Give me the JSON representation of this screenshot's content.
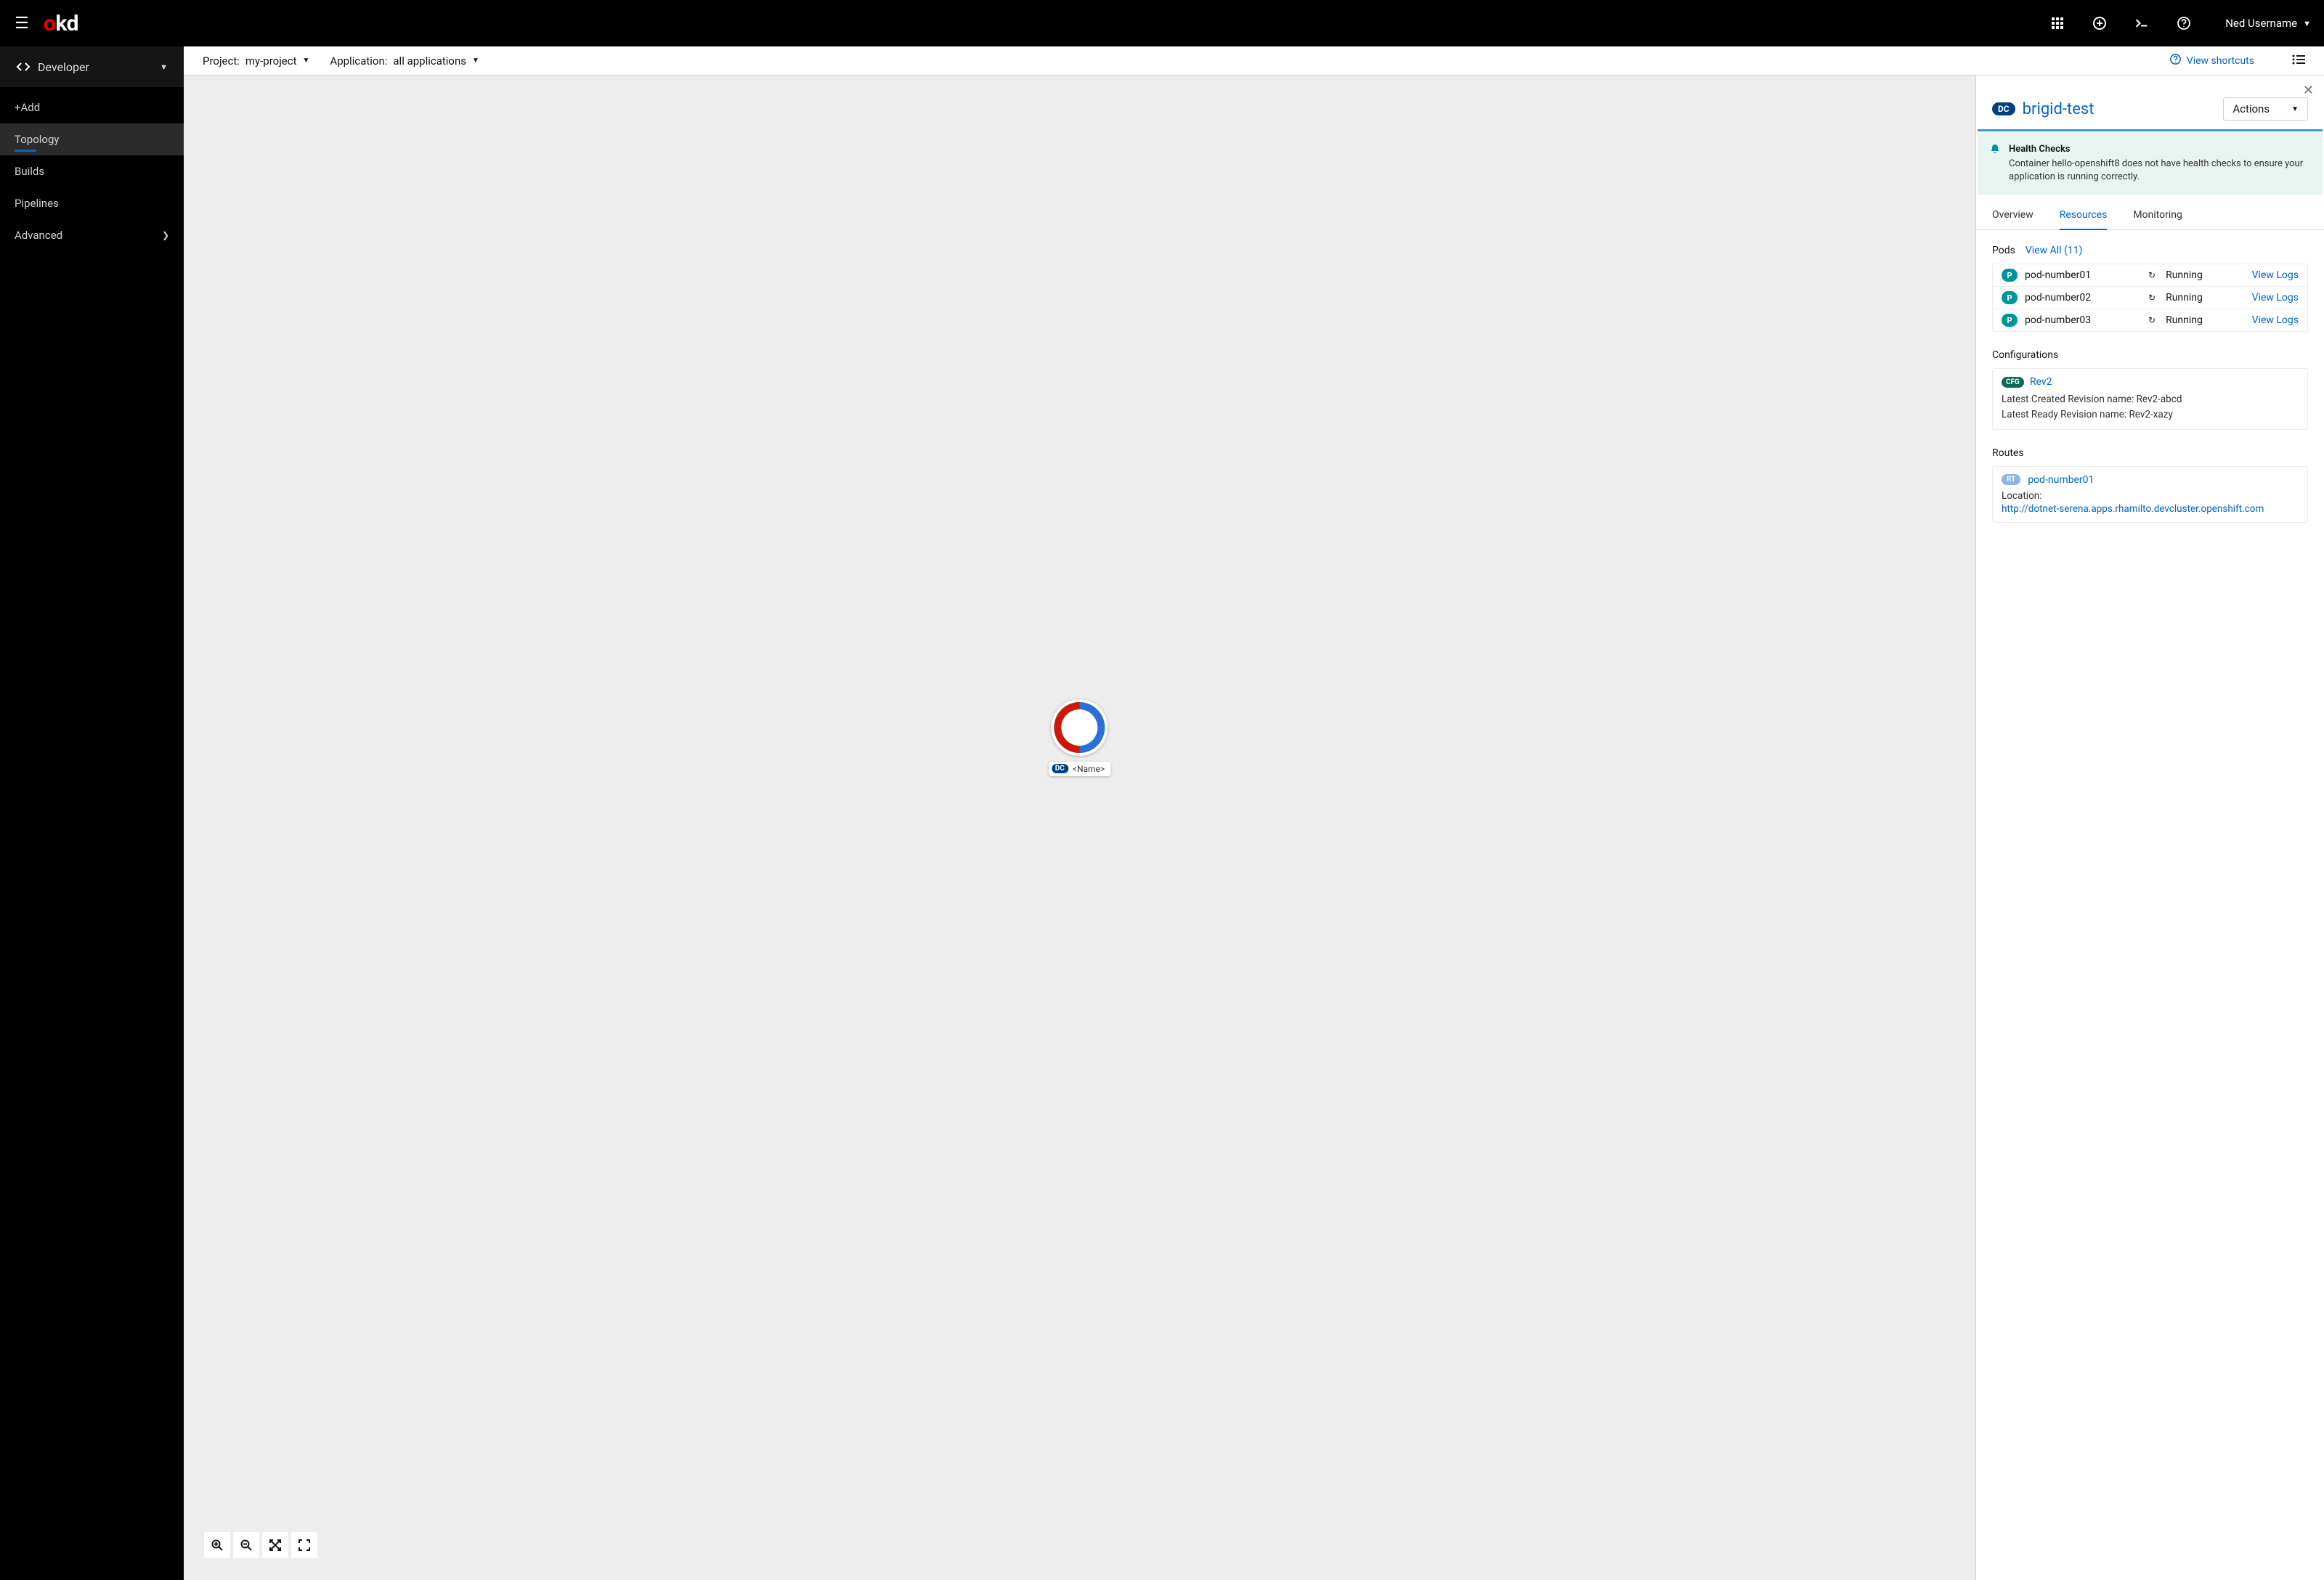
{
  "masthead": {
    "brand_o": "o",
    "brand_kd": "kd",
    "user": "Ned Username"
  },
  "sidebar": {
    "perspective": "Developer",
    "items": [
      {
        "label": "+Add"
      },
      {
        "label": "Topology"
      },
      {
        "label": "Builds"
      },
      {
        "label": "Pipelines"
      },
      {
        "label": "Advanced"
      }
    ]
  },
  "toolbar": {
    "project_label": "Project:",
    "project_value": "my-project",
    "app_label": "Application:",
    "app_value": "all applications",
    "shortcuts": "View shortcuts"
  },
  "node": {
    "badge": "DC",
    "label": "<Name>"
  },
  "panel": {
    "badge": "DC",
    "title": "brigid-test",
    "actions": "Actions",
    "alert": {
      "title": "Health Checks",
      "text": "Container hello-openshift8 does not have health checks to ensure your application is running correctly."
    },
    "tabs": [
      {
        "label": "Overview"
      },
      {
        "label": "Resources"
      },
      {
        "label": "Monitoring"
      }
    ],
    "pods": {
      "title": "Pods",
      "view_all": "View All (11)",
      "items": [
        {
          "badge": "P",
          "name": "pod-number01",
          "status": "Running",
          "logs": "View Logs"
        },
        {
          "badge": "P",
          "name": "pod-number02",
          "status": "Running",
          "logs": "View Logs"
        },
        {
          "badge": "P",
          "name": "pod-number03",
          "status": "Running",
          "logs": "View Logs"
        }
      ]
    },
    "configs": {
      "title": "Configurations",
      "badge": "CFG",
      "name": "Rev2",
      "line1": "Latest Created Revision name: Rev2-abcd",
      "line2": "Latest Ready Revision name: Rev2-xazy"
    },
    "routes": {
      "title": "Routes",
      "badge": "RT",
      "name": "pod-number01",
      "loc_label": "Location:",
      "url": "http://dotnet-serena.apps.rhamilto.devcluster.openshift.com"
    }
  }
}
